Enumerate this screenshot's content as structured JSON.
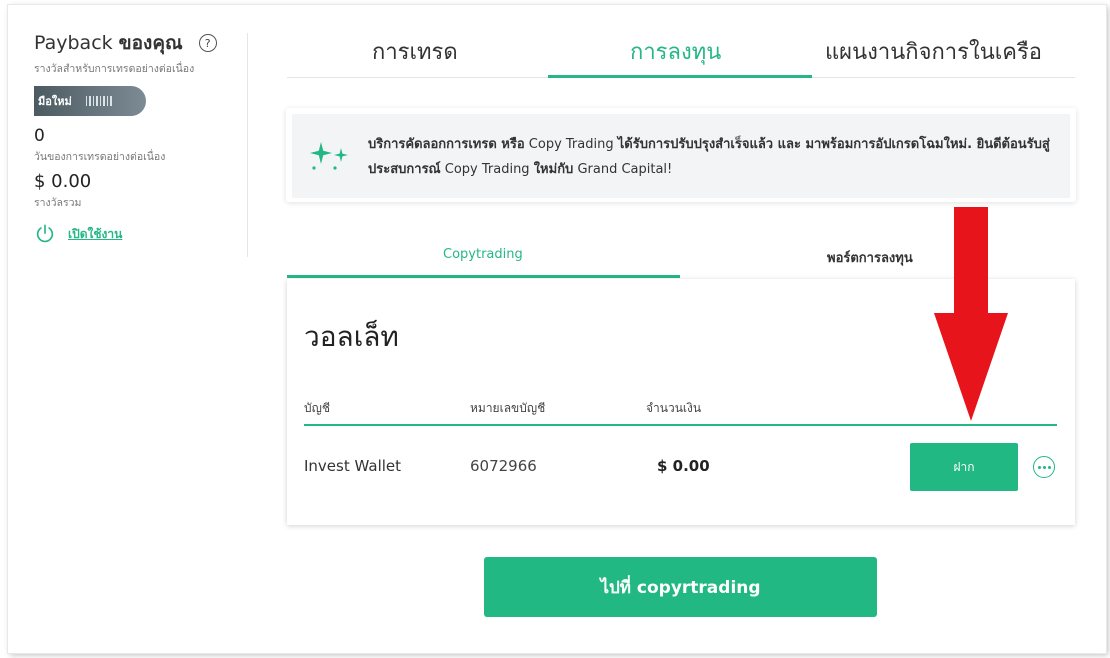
{
  "payback": {
    "title_prefix": "Payback",
    "title_bold": "ของคุณ",
    "help_glyph": "?",
    "subtitle": "รางวัลสำหรับการเทรดอย่างต่อเนื่อง",
    "level_label": "มือใหม่",
    "days_value": "0",
    "days_label": "วันของการเทรดอย่างต่อเนื่อง",
    "total_value": "$ 0.00",
    "total_label": "รางวัลรวม",
    "activate_label": "เปิดใช้งาน"
  },
  "top_tabs": [
    {
      "label": "การเทรด"
    },
    {
      "label": "การลงทุน",
      "active": true
    },
    {
      "label": "แผนงานกิจการในเครือ"
    }
  ],
  "notice": {
    "part1_bold": "บริการคัดลอกการเทรด หรือ",
    "part2": " Copy Trading ",
    "part3_bold": "ได้รับการปรับปรุงสำเร็จแล้ว และ มาพร้อมการอัปเกรดโฉมใหม่. ยินดีต้อนรับสู่ประสบการณ์",
    "part4": " Copy Trading ",
    "part5_bold": "ใหม่กับ",
    "part6": " Grand Capital!"
  },
  "sub_tabs": [
    {
      "label": "Copytrading",
      "active": true
    },
    {
      "label": "พอร์ตการลงทุน"
    }
  ],
  "wallet": {
    "title": "วอลเล็ท",
    "columns": [
      "บัญชี",
      "หมายเลขบัญชี",
      "จำนวนเงิน"
    ],
    "row": {
      "account": "Invest Wallet",
      "number": "6072966",
      "amount": "$ 0.00",
      "deposit_label": "ฝาก"
    }
  },
  "go_button": {
    "label": "ไปที่ copyrtrading"
  },
  "colors": {
    "accent": "#21b883",
    "arrow": "#e8141b"
  }
}
